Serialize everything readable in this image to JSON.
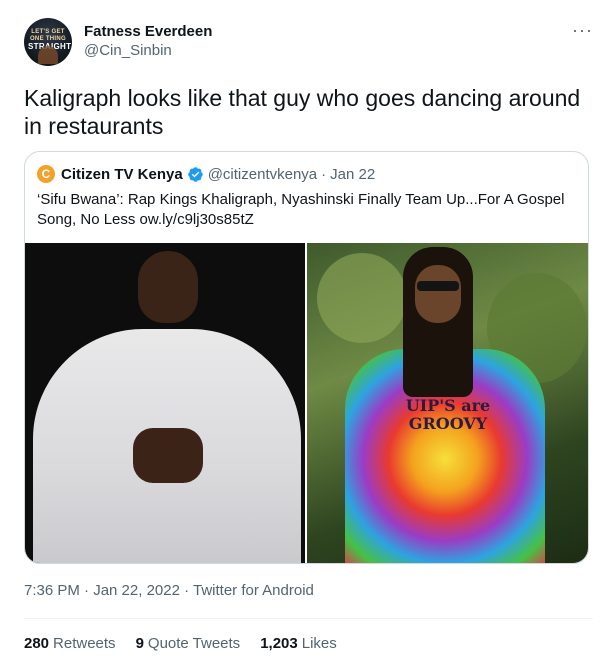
{
  "author": {
    "display_name": "Fatness Everdeen",
    "handle": "@Cin_Sinbin",
    "avatar_text_small": "LET'S GET ONE THING",
    "avatar_text_big": "STRAIGHT"
  },
  "more_label": "···",
  "tweet_text": "Kaligraph looks like that guy who goes dancing around in restaurants",
  "quote": {
    "avatar_letter": "C",
    "name": "Citizen TV Kenya",
    "verified": true,
    "handle": "@citizentvkenya",
    "separator": "·",
    "date": "Jan 22",
    "text": "‘Sifu Bwana’: Rap Kings Khaligraph, Nyashinski Finally Team Up...For A Gospel Song, No Less ow.ly/c9lj30s85tZ",
    "image_shirt_text": "UIP'S are GROOVY"
  },
  "meta": {
    "text": "7:36 PM · Jan 22, 2022 · Twitter for Android"
  },
  "stats": {
    "retweets_count": "280",
    "retweets_label": "Retweets",
    "quotes_count": "9",
    "quotes_label": "Quote Tweets",
    "likes_count": "1,203",
    "likes_label": "Likes"
  },
  "colors": {
    "text_primary": "#0f1419",
    "text_secondary": "#536471",
    "verified_blue": "#1d9bf0",
    "border": "#cfd9de",
    "citizen_orange": "#f2a22a"
  }
}
